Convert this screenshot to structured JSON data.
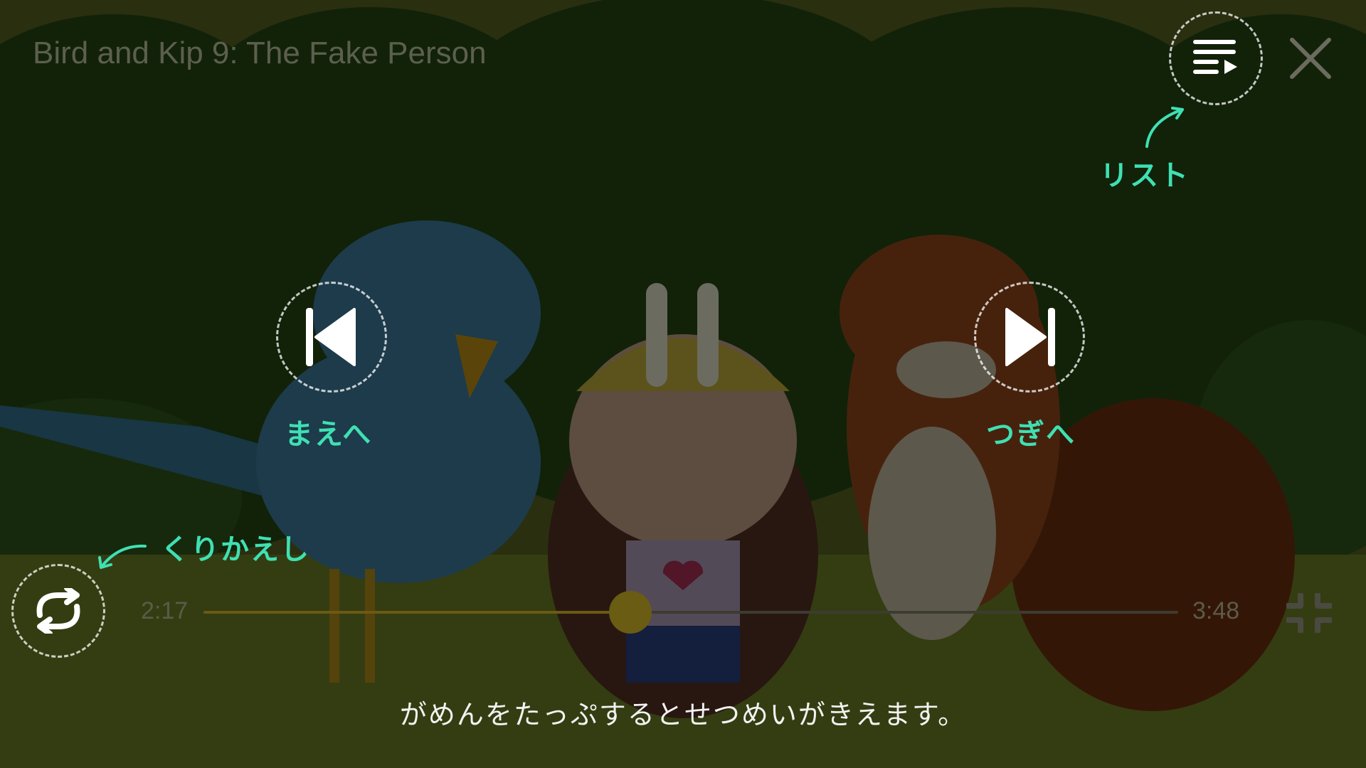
{
  "player": {
    "title": "Bird and Kip 9: The Fake Person",
    "progress": {
      "current": "2:17",
      "total": "3:48",
      "fraction": 0.438
    },
    "caption": "がめんをたっぷするとせつめいがきえます。"
  },
  "hints": {
    "list": "リスト",
    "prev": "まえへ",
    "next": "つぎへ",
    "repeat": "くりかえし"
  },
  "icons": {
    "list": "playlist-icon",
    "close": "close-icon",
    "prev": "skip-previous-icon",
    "pause": "pause-icon",
    "next": "skip-next-icon",
    "repeat": "repeat-icon",
    "minimize": "exit-fullscreen-icon"
  },
  "colors": {
    "hint": "#3fe0b3",
    "seek_thumb": "#6a5c12",
    "overlay": "rgba(0,0,0,0.62)"
  }
}
